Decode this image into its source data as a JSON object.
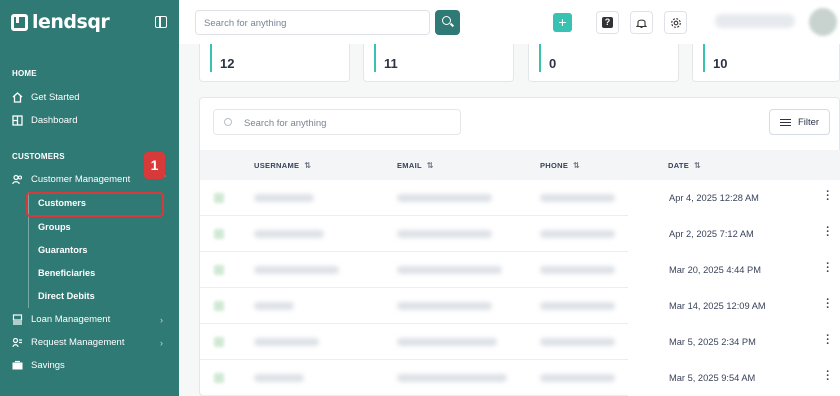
{
  "app": {
    "logo_text": "lendsqr",
    "accent": "#2f7a75",
    "highlight_color": "#d83a3a"
  },
  "sidebar": {
    "home_title": "HOME",
    "get_started": "Get Started",
    "dashboard": "Dashboard",
    "customers_title": "CUSTOMERS",
    "customer_management": "Customer Management",
    "sub_items": [
      "Customers",
      "Groups",
      "Guarantors",
      "Beneficiaries",
      "Direct Debits"
    ],
    "loan_management": "Loan Management",
    "request_management": "Request Management",
    "savings": "Savings",
    "step_badge": "1"
  },
  "topbar": {
    "search_placeholder": "Search for anything",
    "plus_label": "+"
  },
  "stats": [
    "12",
    "11",
    "0",
    "10"
  ],
  "table": {
    "search_placeholder": "Search for anything",
    "filter_label": "Filter",
    "columns": [
      "USERNAME",
      "EMAIL",
      "PHONE",
      "DATE"
    ],
    "dates": [
      "Apr 4, 2025 12:28 AM",
      "Apr 2, 2025 7:12 AM",
      "Mar 20, 2025 4:44 PM",
      "Mar 14, 2025 12:09 AM",
      "Mar 5, 2025 2:34 PM",
      "Mar 5, 2025 9:54 AM"
    ]
  }
}
